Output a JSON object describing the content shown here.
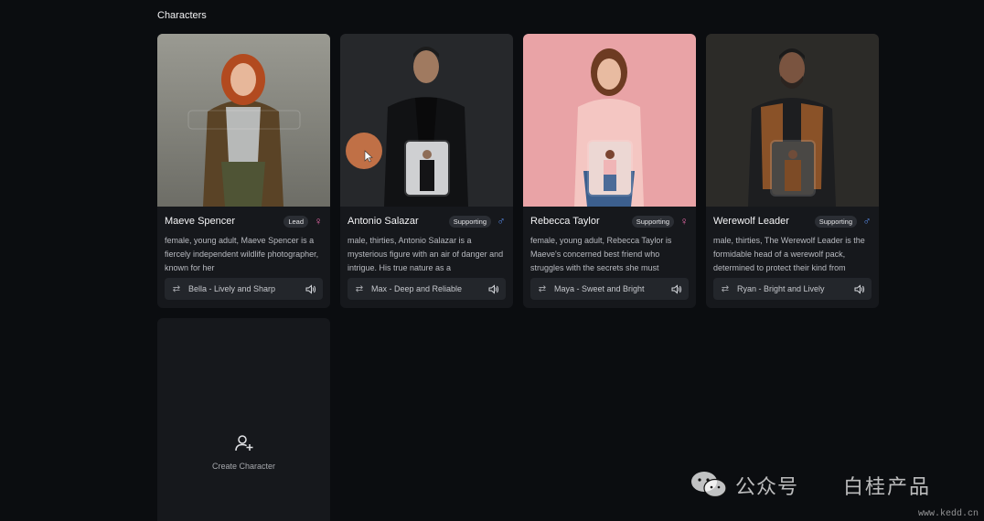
{
  "section": {
    "title": "Characters"
  },
  "characters": [
    {
      "name": "Maeve Spencer",
      "role": "Lead",
      "gender": "female",
      "gender_symbol": "♀",
      "description": "female, young adult, Maeve Spencer is a fiercely independent wildlife photographer, known for her",
      "voice": "Bella - Lively and Sharp",
      "photo_bg": "#8a8a82"
    },
    {
      "name": "Antonio Salazar",
      "role": "Supporting",
      "gender": "male",
      "gender_symbol": "♂",
      "description": "male, thirties, Antonio Salazar is a mysterious figure with an air of danger and intrigue. His true nature as a",
      "voice": "Max - Deep and Reliable",
      "photo_bg": "#26282b"
    },
    {
      "name": "Rebecca Taylor",
      "role": "Supporting",
      "gender": "female",
      "gender_symbol": "♀",
      "description": "female, young adult, Rebecca Taylor is Maeve's concerned best friend who struggles with the secrets she must",
      "voice": "Maya - Sweet and Bright",
      "photo_bg": "#e9a3a6"
    },
    {
      "name": "Werewolf Leader",
      "role": "Supporting",
      "gender": "male",
      "gender_symbol": "♂",
      "description": "male, thirties, The Werewolf Leader is the formidable head of a werewolf pack, determined to protect their kind from",
      "voice": "Ryan - Bright and Lively",
      "photo_bg": "#2c2b28"
    }
  ],
  "create": {
    "label": "Create Character"
  },
  "watermark": {
    "text1": "公众号",
    "text2": "白桂产品",
    "url": "www.kedd.cn"
  },
  "colors": {
    "background": "#0b0d10",
    "card": "#16181c",
    "female": "#e86aa8",
    "male": "#5b8ff0",
    "cursor": "#d67a4a"
  }
}
